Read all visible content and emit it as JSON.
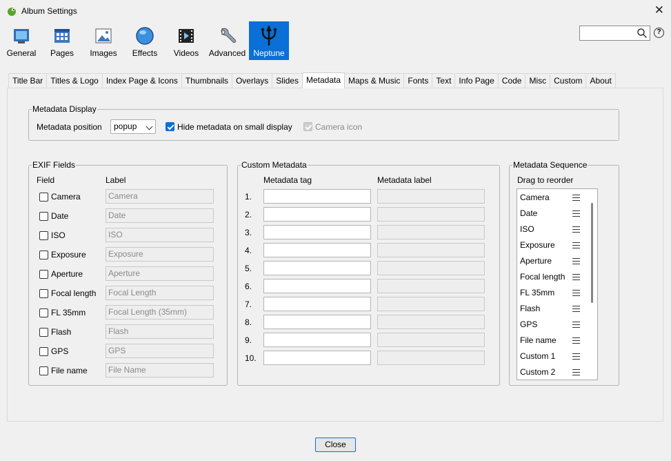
{
  "window": {
    "title": "Album Settings",
    "close_glyph": "✕"
  },
  "toolbar": {
    "items": [
      {
        "label": "General",
        "icon": "general-icon"
      },
      {
        "label": "Pages",
        "icon": "pages-icon"
      },
      {
        "label": "Images",
        "icon": "images-icon"
      },
      {
        "label": "Effects",
        "icon": "effects-icon"
      },
      {
        "label": "Videos",
        "icon": "videos-icon"
      },
      {
        "label": "Advanced",
        "icon": "wrench-icon"
      },
      {
        "label": "Neptune",
        "icon": "trident-icon",
        "active": true
      }
    ],
    "search": {
      "value": "",
      "placeholder": ""
    },
    "help_glyph": "?"
  },
  "tabs": [
    {
      "label": "Title Bar"
    },
    {
      "label": "Titles & Logo"
    },
    {
      "label": "Index Page & Icons"
    },
    {
      "label": "Thumbnails"
    },
    {
      "label": "Overlays"
    },
    {
      "label": "Slides"
    },
    {
      "label": "Metadata",
      "active": true
    },
    {
      "label": "Maps & Music"
    },
    {
      "label": "Fonts"
    },
    {
      "label": "Text"
    },
    {
      "label": "Info Page"
    },
    {
      "label": "Code"
    },
    {
      "label": "Misc"
    },
    {
      "label": "Custom"
    },
    {
      "label": "About"
    }
  ],
  "metadata_display": {
    "legend": "Metadata Display",
    "position_label": "Metadata position",
    "position_value": "popup",
    "hide_small_label": "Hide metadata on small display",
    "hide_small_checked": true,
    "camera_icon_label": "Camera icon",
    "camera_icon_checked": true,
    "camera_icon_disabled": true
  },
  "exif": {
    "legend": "EXIF Fields",
    "col_field": "Field",
    "col_label": "Label",
    "rows": [
      {
        "field": "Camera",
        "label": "Camera"
      },
      {
        "field": "Date",
        "label": "Date"
      },
      {
        "field": "ISO",
        "label": "ISO"
      },
      {
        "field": "Exposure",
        "label": "Exposure"
      },
      {
        "field": "Aperture",
        "label": "Aperture"
      },
      {
        "field": "Focal length",
        "label": "Focal Length"
      },
      {
        "field": "FL 35mm",
        "label": "Focal Length (35mm)"
      },
      {
        "field": "Flash",
        "label": "Flash"
      },
      {
        "field": "GPS",
        "label": "GPS"
      },
      {
        "field": "File name",
        "label": "File Name"
      }
    ]
  },
  "custom": {
    "legend": "Custom Metadata",
    "col_tag": "Metadata tag",
    "col_label": "Metadata label",
    "rows": [
      {
        "num": "1.",
        "tag": "",
        "label": ""
      },
      {
        "num": "2.",
        "tag": "",
        "label": ""
      },
      {
        "num": "3.",
        "tag": "",
        "label": ""
      },
      {
        "num": "4.",
        "tag": "",
        "label": ""
      },
      {
        "num": "5.",
        "tag": "",
        "label": ""
      },
      {
        "num": "6.",
        "tag": "",
        "label": ""
      },
      {
        "num": "7.",
        "tag": "",
        "label": ""
      },
      {
        "num": "8.",
        "tag": "",
        "label": ""
      },
      {
        "num": "9.",
        "tag": "",
        "label": ""
      },
      {
        "num": "10.",
        "tag": "",
        "label": ""
      }
    ]
  },
  "sequence": {
    "legend": "Metadata Sequence",
    "hint": "Drag to reorder",
    "items": [
      "Camera",
      "Date",
      "ISO",
      "Exposure",
      "Aperture",
      "Focal length",
      "FL 35mm",
      "Flash",
      "GPS",
      "File name",
      "Custom 1",
      "Custom 2"
    ]
  },
  "footer": {
    "close_label": "Close"
  },
  "colors": {
    "accent": "#0a6fd6",
    "background": "#f0f0f0"
  }
}
